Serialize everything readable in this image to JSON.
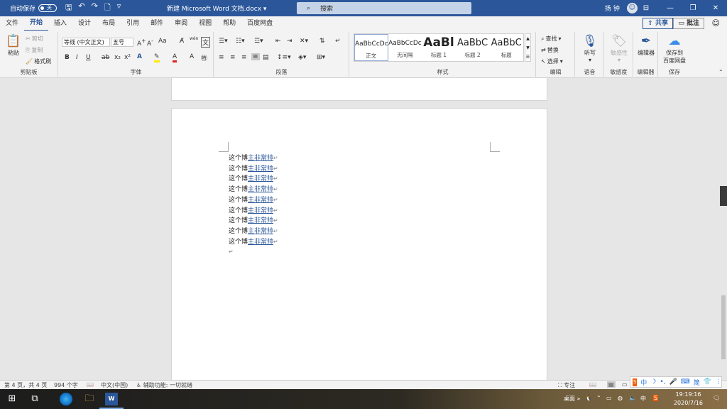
{
  "titlebar": {
    "autosave_label": "自动保存",
    "autosave_state": "关",
    "doc_title": "新建 Microsoft Word 文档.docx",
    "search_placeholder": "搜索",
    "user_name": "扬 钟"
  },
  "tabs": [
    "文件",
    "开始",
    "插入",
    "设计",
    "布局",
    "引用",
    "邮件",
    "审阅",
    "视图",
    "帮助",
    "百度网盘"
  ],
  "active_tab": "开始",
  "tab_actions": {
    "share": "共享",
    "comment": "批注"
  },
  "ribbon": {
    "clipboard": {
      "label": "剪贴板",
      "paste": "粘贴",
      "cut": "剪切",
      "copy": "复制",
      "format_painter": "格式刷"
    },
    "font": {
      "label": "字体",
      "font_name": "等线 (中文正文)",
      "font_size": "五号",
      "bold": "B",
      "italic": "I",
      "underline": "U",
      "aa": "Aa",
      "phonetic": "wén",
      "wen": "文"
    },
    "paragraph": {
      "label": "段落"
    },
    "styles": {
      "label": "样式",
      "items": [
        {
          "sample": "AaBbCcDc",
          "name": "正文"
        },
        {
          "sample": "AaBbCcDc",
          "name": "无间隔"
        },
        {
          "sample": "AaBl",
          "name": "标题 1"
        },
        {
          "sample": "AaBbC",
          "name": "标题 2"
        },
        {
          "sample": "AaBbC",
          "name": "标题"
        }
      ]
    },
    "editing": {
      "label": "编辑",
      "find": "查找",
      "replace": "替换",
      "select": "选择"
    },
    "voice": {
      "label": "语音",
      "dictate": "听写"
    },
    "sensitivity": {
      "label": "敏感度",
      "button": "敏感性"
    },
    "editor": {
      "label": "编辑器",
      "button": "编辑器"
    },
    "save": {
      "label": "保存",
      "button_line1": "保存到",
      "button_line2": "百度网盘"
    }
  },
  "document": {
    "lines": [
      {
        "prefix": "这个博",
        "underlined": "主非常帅"
      },
      {
        "prefix": "这个博",
        "underlined": "主非常帅"
      },
      {
        "prefix": "这个博",
        "underlined": "主非常帅"
      },
      {
        "prefix": "这个博",
        "underlined": "主非常帅"
      },
      {
        "prefix": "这个博",
        "underlined": "主非常帅"
      },
      {
        "prefix": "这个博",
        "underlined": "主非常帅"
      },
      {
        "prefix": "这个博",
        "underlined": "主非常帅"
      },
      {
        "prefix": "这个博",
        "underlined": "主非常帅"
      },
      {
        "prefix": "这个博",
        "underlined": "主非常帅"
      }
    ],
    "paragraph_mark": "↵"
  },
  "statusbar": {
    "page": "第 4 页，共 4 页",
    "words": "994 个字",
    "language": "中文(中国)",
    "accessibility": "辅助功能: 一切就绪",
    "focus": "专注"
  },
  "ime": {
    "mode": "中",
    "simplified": "简"
  },
  "taskbar": {
    "desktop": "桌面",
    "ime_char": "中",
    "time": "19:19:16",
    "date": "2020/7/16"
  }
}
